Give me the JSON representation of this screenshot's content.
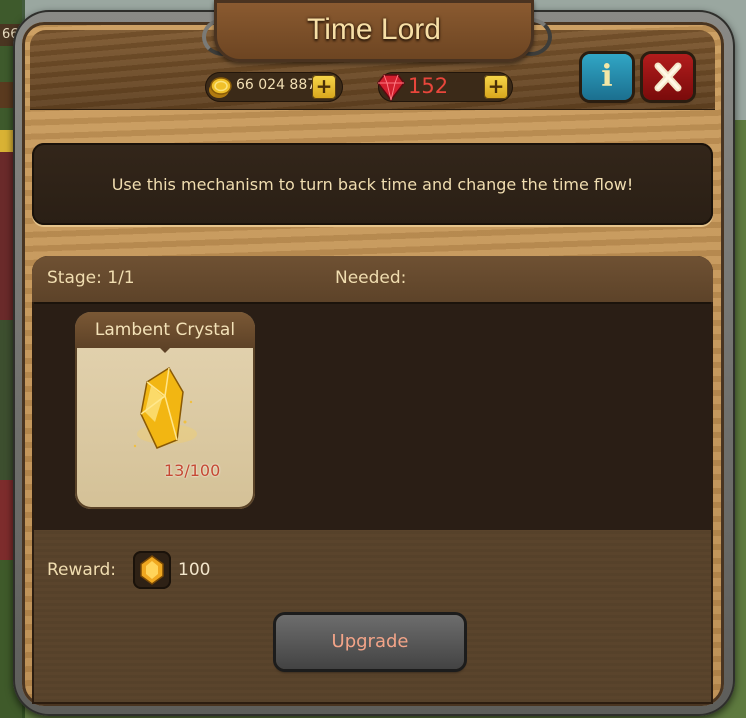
{
  "background": {
    "left_counter": "66"
  },
  "window": {
    "title": "Time Lord"
  },
  "currencies": {
    "gold_value": "66 024 887",
    "gems_value": "152",
    "plus_symbol": "+"
  },
  "buttons": {
    "info_label": "i",
    "close_label": "✕",
    "upgrade_label": "Upgrade"
  },
  "description": "Use this mechanism to turn back time and change the time flow!",
  "stage": {
    "stage_text": "Stage: 1/1",
    "needed_text": "Needed:"
  },
  "requirement": {
    "item_name": "Lambent Crystal",
    "progress": "13/100",
    "current": 13,
    "required": 100
  },
  "reward": {
    "label": "Reward:",
    "value": "100"
  },
  "colors": {
    "title": "#f7dfa6",
    "gem_value": "#e8463b",
    "progress": "#c54933",
    "upgrade_text": "#f3a488"
  },
  "icons": {
    "coin": "gold-coin-icon",
    "gem": "ruby-gem-icon",
    "item": "yellow-crystal-icon",
    "reward": "gold-star-gem-icon"
  }
}
